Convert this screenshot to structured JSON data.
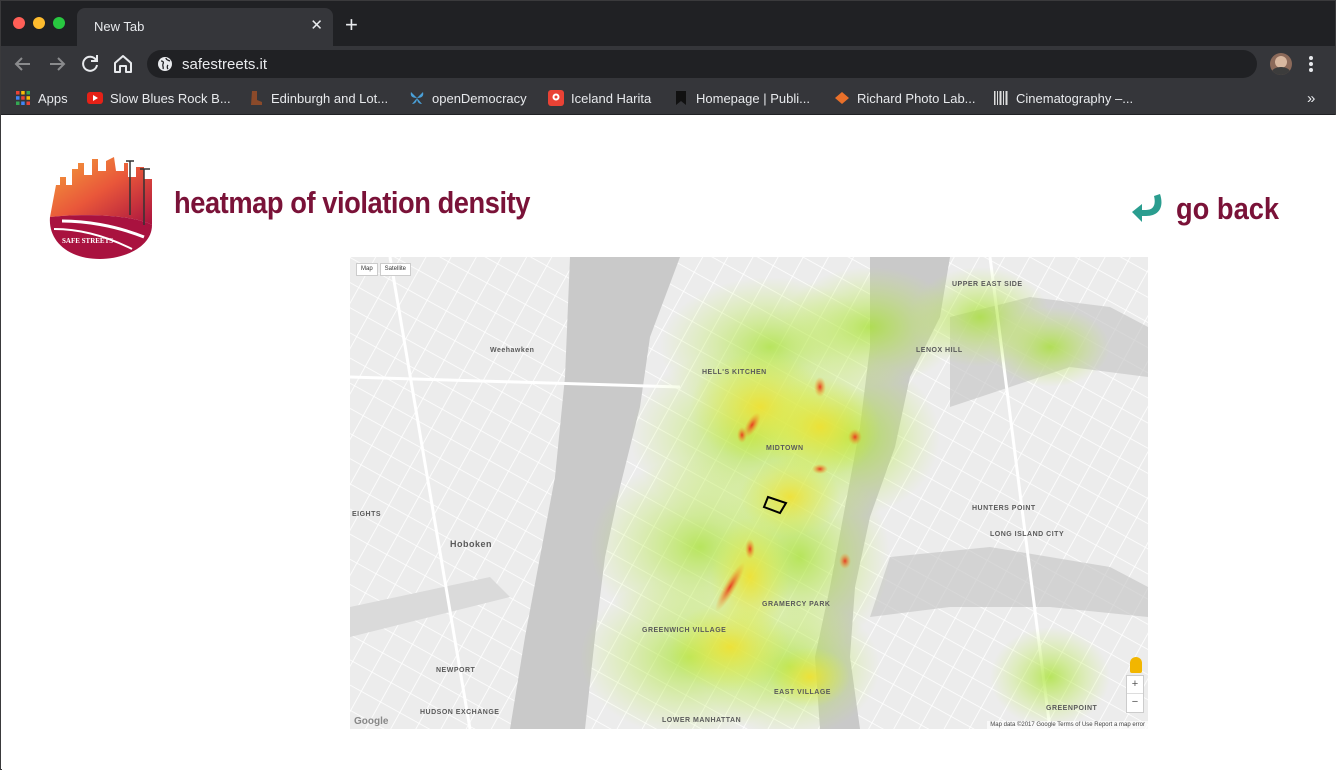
{
  "browser": {
    "tab_title": "New Tab",
    "url": "safestreets.it",
    "bookmarks": [
      {
        "label": "Apps",
        "icon": "apps-grid-icon",
        "color": "#4285f4"
      },
      {
        "label": "Slow Blues Rock B...",
        "icon": "youtube-icon",
        "color": "#e62117"
      },
      {
        "label": "Edinburgh and Lot...",
        "icon": "boot-icon",
        "color": "#8b4a2a"
      },
      {
        "label": "openDemocracy",
        "icon": "butterfly-icon",
        "color": "#4aa0d8"
      },
      {
        "label": "Iceland Harita",
        "icon": "map-pin-icon",
        "color": "#e94235"
      },
      {
        "label": "Homepage | Publi...",
        "icon": "bookmark-icon",
        "color": "#111111"
      },
      {
        "label": "Richard Photo Lab...",
        "icon": "diamond-icon",
        "color": "#e9702a"
      },
      {
        "label": "Cinematography –...",
        "icon": "barcode-icon",
        "color": "#dddddd"
      }
    ],
    "overflow_label": "»"
  },
  "page": {
    "logo_text": "SAFE STREETS",
    "title": "heatmap of violation density",
    "go_back_label": "go back",
    "accent_color": "#7a1238",
    "arrow_color": "#2a9d8f"
  },
  "map": {
    "controls": [
      "Map",
      "Satellite"
    ],
    "zoom_in": "+",
    "zoom_out": "−",
    "google_label": "Google",
    "attribution": "Map data ©2017 Google   Terms of Use   Report a map error",
    "labels": {
      "upper_east_side": "UPPER EAST SIDE",
      "hells_kitchen": "HELL'S KITCHEN",
      "lenox_hill": "LENOX HILL",
      "midtown": "MIDTOWN",
      "weehawken": "Weehawken",
      "hoboken": "Hoboken",
      "hunters_point": "HUNTERS POINT",
      "long_island_city": "LONG ISLAND CITY",
      "gramercy_park": "GRAMERCY PARK",
      "greenwich_village": "GREENWICH VILLAGE",
      "newport": "NEWPORT",
      "hudson_exchange": "HUDSON EXCHANGE",
      "east_village": "EAST VILLAGE",
      "greenpoint": "GREENPOINT",
      "lower_manhattan": "LOWER MANHATTAN",
      "heights": "EIGHTS"
    }
  }
}
